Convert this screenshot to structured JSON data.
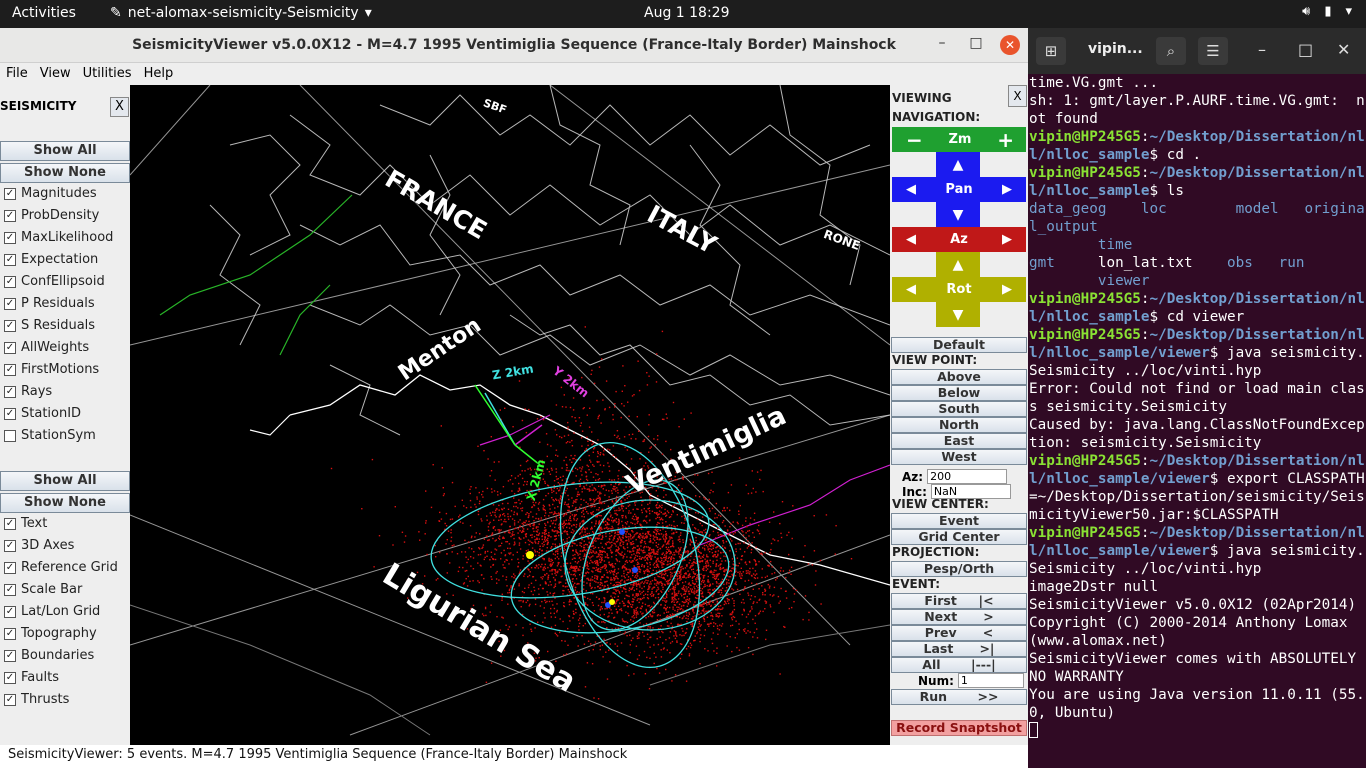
{
  "topbar": {
    "activities": "Activities",
    "app_name": "net-alomax-seismicity-Seismicity",
    "clock": "Aug 1  18:29"
  },
  "window": {
    "title": "SeismicityViewer v5.0.0X12 - M=4.7 1995 Ventimiglia Sequence (France-Italy Border) Mainshock",
    "menu": [
      "File",
      "View",
      "Utilities",
      "Help"
    ]
  },
  "left_panel": {
    "header": "SEISMICITY",
    "close": "X",
    "show_all": "Show All",
    "show_none": "Show None",
    "layers_a": [
      {
        "label": "Magnitudes",
        "checked": true
      },
      {
        "label": "ProbDensity",
        "checked": true
      },
      {
        "label": "MaxLikelihood",
        "checked": true
      },
      {
        "label": "Expectation",
        "checked": true
      },
      {
        "label": "ConfEllipsoid",
        "checked": true
      },
      {
        "label": "P Residuals",
        "checked": true
      },
      {
        "label": "S Residuals",
        "checked": true
      },
      {
        "label": "AllWeights",
        "checked": true
      },
      {
        "label": "FirstMotions",
        "checked": true
      },
      {
        "label": "Rays",
        "checked": true
      },
      {
        "label": "StationID",
        "checked": true
      },
      {
        "label": "StationSym",
        "checked": false
      }
    ],
    "show_all_2": "Show All",
    "show_none_2": "Show None",
    "layers_b": [
      {
        "label": "Text",
        "checked": true
      },
      {
        "label": "3D Axes",
        "checked": true
      },
      {
        "label": "Reference Grid",
        "checked": true
      },
      {
        "label": "Scale Bar",
        "checked": true
      },
      {
        "label": "Lat/Lon Grid",
        "checked": true
      },
      {
        "label": "Topography",
        "checked": true
      },
      {
        "label": "Boundaries",
        "checked": true
      },
      {
        "label": "Faults",
        "checked": true
      },
      {
        "label": "Thrusts",
        "checked": true
      }
    ]
  },
  "map": {
    "labels": {
      "france": "FRANCE",
      "italy": "ITALY",
      "menton": "Menton",
      "ventimiglia": "Ventimiglia",
      "ligurian": "Ligurian Sea",
      "sbf": "SBF",
      "rone": "RONE",
      "axis_z": "Z 2km",
      "axis_y": "Y 2km",
      "axis_x": "X 2km"
    }
  },
  "right_panel": {
    "viewing": "VIEWING",
    "close": "X",
    "navigation": "NAVIGATION:",
    "zoom": "Zm",
    "pan": "Pan",
    "az": "Az",
    "rot": "Rot",
    "default": "Default",
    "view_point": "VIEW POINT:",
    "above": "Above",
    "below": "Below",
    "south": "South",
    "north": "North",
    "east": "East",
    "west": "West",
    "az_label": "Az:",
    "az_value": "200",
    "inc_label": "Inc:",
    "inc_value": "NaN",
    "view_center": "VIEW CENTER:",
    "event_btn": "Event",
    "grid_center": "Grid Center",
    "projection": "PROJECTION:",
    "pesp": "Pesp/Orth",
    "event_hdr": "EVENT:",
    "first": "First     |<",
    "next": "Next      >",
    "prev": "Prev      <",
    "last": "Last      >|",
    "all": "All       |---|",
    "num_label": "Num:",
    "num_value": "1",
    "run": "Run       >>",
    "snapshot": "Record Snaptshot"
  },
  "status_bar": "SeismicityViewer: 5 events. M=4.7 1995 Ventimiglia Sequence (France-Italy Border) Mainshock",
  "terminal": {
    "title": "vipin...",
    "prompt_user": "vipin@HP245G5",
    "lines": [
      {
        "t": "out",
        "text": "time.VG.gmt ..."
      },
      {
        "t": "out",
        "text": "sh: 1: gmt/layer.P.AURF.time.VG.gmt:  not found"
      },
      {
        "t": "cmd",
        "path": "~/Desktop/Dissertation/nll/nlloc_sample",
        "text": "$ cd ."
      },
      {
        "t": "cmd",
        "path": "~/Desktop/Dissertation/nll/nlloc_sample",
        "text": "$ ls"
      },
      {
        "t": "ls",
        "text": ""
      },
      {
        "t": "cmd",
        "path": "~/Desktop/Dissertation/nll/nlloc_sample",
        "text": "$ cd viewer"
      },
      {
        "t": "cmd",
        "path": "~/Desktop/Dissertation/nll/nlloc_sample/viewer",
        "text": "$ java seismicity.Seismicity ../loc/vinti.hyp"
      },
      {
        "t": "out",
        "text": "Error: Could not find or load main class seismicity.Seismicity"
      },
      {
        "t": "out",
        "text": "Caused by: java.lang.ClassNotFoundException: seismicity.Seismicity"
      },
      {
        "t": "cmd",
        "path": "~/Desktop/Dissertation/nll/nlloc_sample/viewer",
        "text": "$ export CLASSPATH=~/Desktop/Dissertation/seismicity/SeismicityViewer50.jar:$CLASSPATH"
      },
      {
        "t": "cmd",
        "path": "~/Desktop/Dissertation/nll/nlloc_sample/viewer",
        "text": "$ java seismicity.Seismicity ../loc/vinti.hyp"
      },
      {
        "t": "out",
        "text": "image2Dstr null"
      },
      {
        "t": "out",
        "text": "SeismicityViewer v5.0.0X12 (02Apr2014)"
      },
      {
        "t": "out",
        "text": "Copyright (C) 2000-2014 Anthony Lomax (www.alomax.net)"
      },
      {
        "t": "out",
        "text": "SeismicityViewer comes with ABSOLUTELY NO WARRANTY"
      },
      {
        "t": "out",
        "text": "You are using Java version 11.0.11 (55.0, Ubuntu)"
      }
    ],
    "ls_items": [
      {
        "name": "data_geog",
        "dir": true
      },
      {
        "name": "loc",
        "dir": true
      },
      {
        "name": "model",
        "dir": true
      },
      {
        "name": "original_output",
        "dir": true
      },
      {
        "name": "time",
        "dir": true
      },
      {
        "name": "gmt",
        "dir": true
      },
      {
        "name": "lon_lat.txt",
        "dir": false
      },
      {
        "name": "obs",
        "dir": true
      },
      {
        "name": "run",
        "dir": true
      },
      {
        "name": "viewer",
        "dir": true
      }
    ]
  },
  "colors": {
    "zoom_green": "#1fa030",
    "pan_blue": "#1b1bf0",
    "az_red": "#c01818",
    "rot_olive": "#b0b000",
    "ellipse_cyan": "#40e0e0",
    "scatter_red": "#d81010",
    "terminal_bg": "#300a24"
  }
}
